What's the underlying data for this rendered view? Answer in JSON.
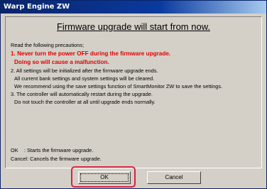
{
  "window": {
    "title": "Warp Engine ZW"
  },
  "dialog": {
    "heading": "Firmware upgrade will start from now.",
    "intro": "Read the following precautions;",
    "items": [
      {
        "text": "1. Never turn the power OFF during the firmware upgrade.",
        "style": "warn"
      },
      {
        "text": "Doing so will cause a malfunction.",
        "style": "warn-indent"
      },
      {
        "text": "2. All settings will be initialized after the firmware upgrade ends.",
        "style": "normal"
      },
      {
        "text": "All current bank settings and system settings will be cleared.",
        "style": "indent"
      },
      {
        "text": "We recommend using the save settings function of SmartMonitor ZW to save the settings.",
        "style": "indent"
      },
      {
        "text": "3. The controller will automatically restart during the upgrade.",
        "style": "normal"
      },
      {
        "text": "Do not touch the controller at all until upgrade ends normally.",
        "style": "indent"
      }
    ],
    "ok_hint": "OK    : Starts the firmware upgrade.",
    "cancel_hint": "Cancel: Cancels the firmware upgrade."
  },
  "buttons": {
    "ok_label": "OK",
    "cancel_label": "Cancel"
  },
  "colors": {
    "warning": "#e00000",
    "highlight": "#d9233f",
    "titlebar": "#0a246a"
  }
}
